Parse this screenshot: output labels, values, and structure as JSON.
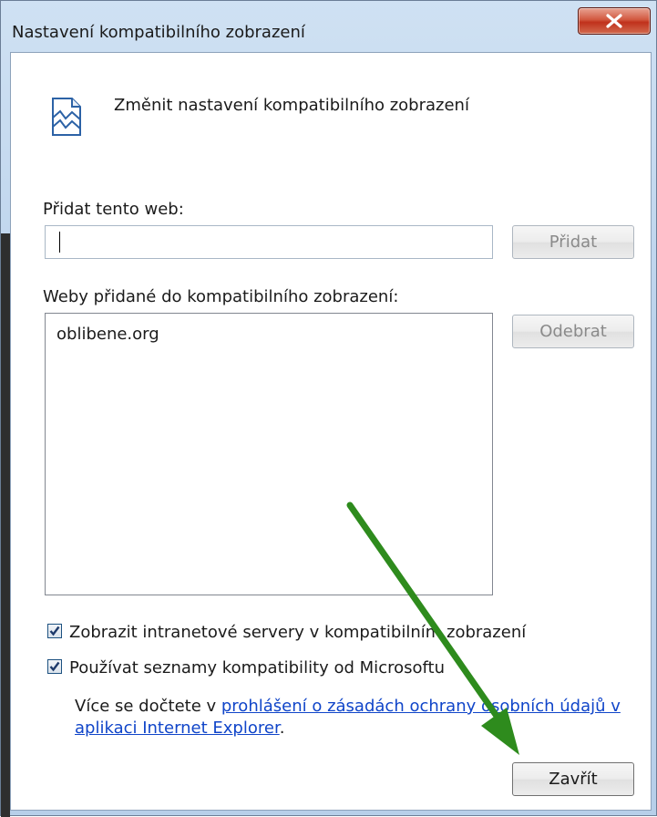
{
  "window": {
    "title": "Nastavení kompatibilního zobrazení",
    "close_label": "x"
  },
  "header": {
    "icon": "broken-page-icon",
    "text": "Změnit nastavení kompatibilního zobrazení"
  },
  "add_site": {
    "label": "Přidat tento web:",
    "value": "",
    "button_label": "Přidat"
  },
  "sites_list": {
    "label": "Weby přidané do kompatibilního zobrazení:",
    "items": [
      "oblibene.org"
    ],
    "remove_label": "Odebrat"
  },
  "options": {
    "intranet": {
      "label": "Zobrazit intranetové servery v kompatibilním zobrazení",
      "checked": true
    },
    "ms_lists": {
      "label": "Používat seznamy kompatibility od Microsoftu",
      "checked": true
    }
  },
  "info": {
    "prefix": "Více se dočtete v ",
    "link_text": "prohlášení o zásadách ochrany osobních údajů v aplikaci Internet Explorer",
    "suffix": "."
  },
  "footer": {
    "close_label": "Zavřít"
  },
  "colors": {
    "arrow": "#2e8b1d",
    "link": "#1045c9",
    "close_button": "#c0311c"
  }
}
